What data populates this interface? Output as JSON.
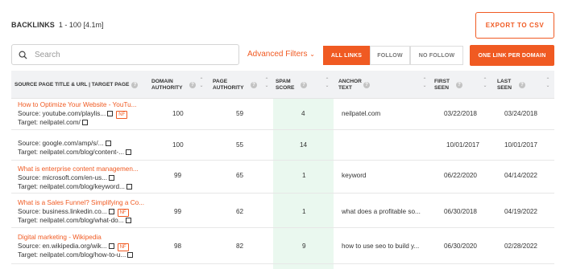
{
  "header": {
    "title": "BACKLINKS",
    "range": "1 - 100 [4.1m]",
    "export_label": "EXPORT TO CSV"
  },
  "toolbar": {
    "search_placeholder": "Search",
    "advanced_filters": "Advanced Filters",
    "segments": [
      "ALL LINKS",
      "FOLLOW",
      "NO FOLLOW"
    ],
    "active_segment": "ALL LINKS",
    "one_link": "ONE LINK PER DOMAIN"
  },
  "columns": [
    {
      "key": "source",
      "label": "SOURCE PAGE TITLE & URL | TARGET PAGE"
    },
    {
      "key": "da",
      "label": "DOMAIN AUTHORITY"
    },
    {
      "key": "pa",
      "label": "PAGE AUTHORITY"
    },
    {
      "key": "spam",
      "label": "SPAM SCORE"
    },
    {
      "key": "anchor",
      "label": "ANCHOR TEXT"
    },
    {
      "key": "first",
      "label": "FIRST SEEN"
    },
    {
      "key": "last",
      "label": "LAST SEEN"
    }
  ],
  "rows": [
    {
      "title": "How to Optimize Your Website - YouTu...",
      "source": "Source: youtube.com/playlis...",
      "target": "Target: neilpatel.com/",
      "nf": "NF",
      "da": "100",
      "pa": "59",
      "spam": "4",
      "anchor": "neilpatel.com",
      "first": "03/22/2018",
      "last": "03/24/2018"
    },
    {
      "title": "",
      "source": "Source: google.com/amp/s/...",
      "target": "Target: neilpatel.com/blog/content-...",
      "nf": "",
      "da": "100",
      "pa": "55",
      "spam": "14",
      "anchor": "",
      "first": "10/01/2017",
      "last": "10/01/2017"
    },
    {
      "title": "What is enterprise content managemen...",
      "source": "Source: microsoft.com/en-us...",
      "target": "Target: neilpatel.com/blog/keyword...",
      "nf": "",
      "da": "99",
      "pa": "65",
      "spam": "1",
      "anchor": "keyword",
      "first": "06/22/2020",
      "last": "04/14/2022"
    },
    {
      "title": "What is a Sales Funnel? Simplifying a Co...",
      "source": "Source: business.linkedin.co...",
      "target": "Target: neilpatel.com/blog/what-do...",
      "nf": "NF",
      "da": "99",
      "pa": "62",
      "spam": "1",
      "anchor": "what does a profitable so...",
      "first": "06/30/2018",
      "last": "04/19/2022"
    },
    {
      "title": "Digital marketing - Wikipedia",
      "source": "Source: en.wikipedia.org/wik...",
      "target": "Target: neilpatel.com/blog/how-to-u...",
      "nf": "NF",
      "da": "98",
      "pa": "82",
      "spam": "9",
      "anchor": "how to use seo to build y...",
      "first": "06/30/2020",
      "last": "02/28/2022"
    }
  ],
  "colors": {
    "accent": "#f05a22",
    "spam_bg": "#eaf8ef",
    "header_bg": "#f1f2f4"
  }
}
